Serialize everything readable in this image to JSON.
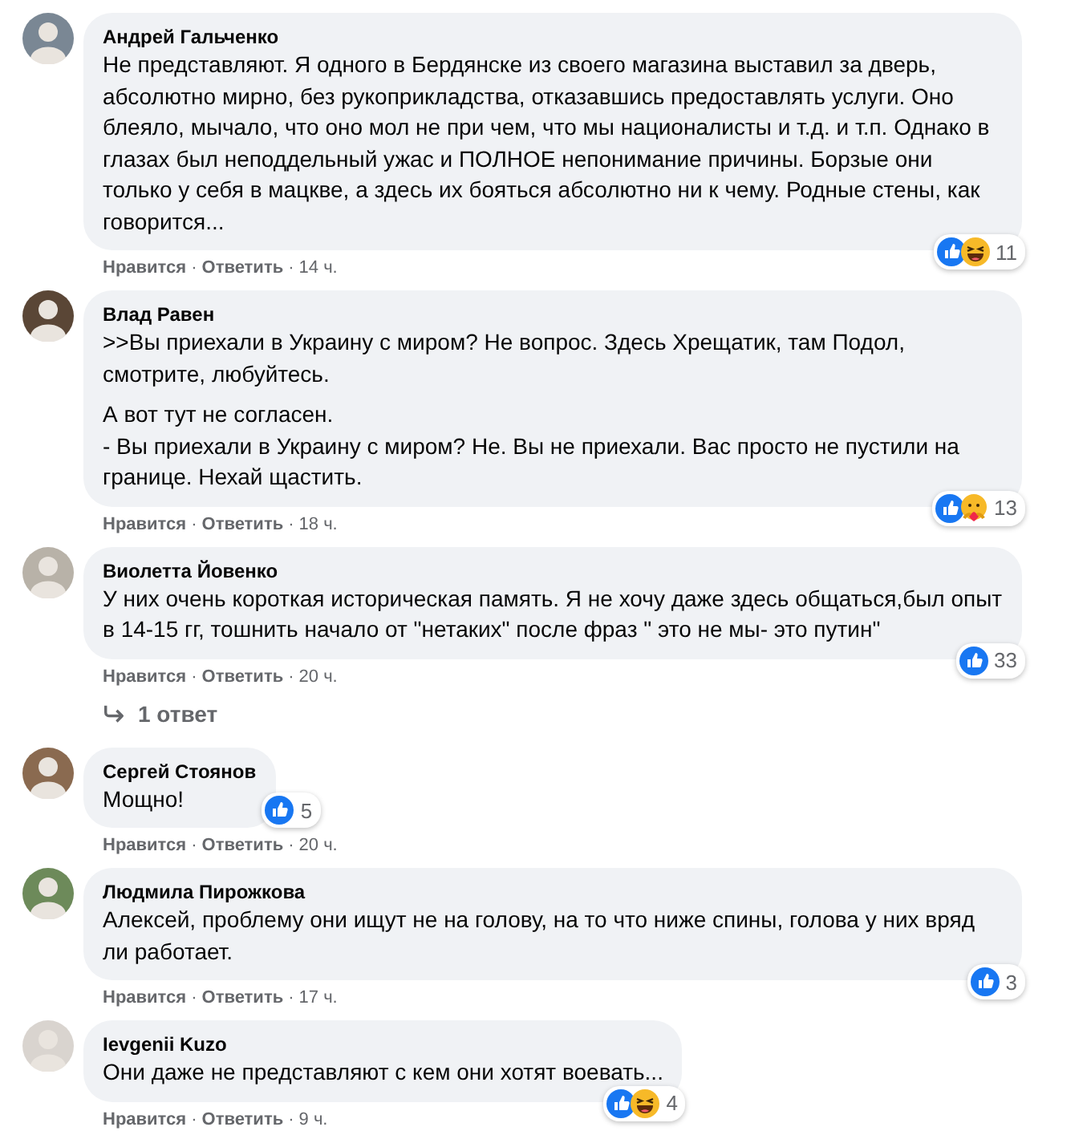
{
  "separator": "·",
  "comments": [
    {
      "author": "Андрей Гальченко",
      "paragraphs": [
        "Не представляют. Я одного в Бердянске из своего магазина выставил за дверь, абсолютно мирно, без рукоприкладства, отказавшись предоставлять услуги. Оно блеяло, мычало, что оно мол не при чем, что мы националисты и т.д. и т.п. Однако в глазах был неподдельный ужас и ПОЛНОЕ непонимание причины. Борзые они только у себя в мацкве, а здесь их бояться абсолютно ни к чему. Родные стены, как говорится..."
      ],
      "reactions": [
        {
          "kind": "like"
        },
        {
          "kind": "haha"
        }
      ],
      "reaction_count": "11",
      "like_label": "Нравится",
      "reply_label": "Ответить",
      "time": "14 ч."
    },
    {
      "author": "Влад Равен",
      "paragraphs": [
        ">>Вы приехали в Украину с миром? Не вопрос. Здесь Хрещатик, там Подол, смотрите, любуйтесь.",
        "А вот тут не согласен.\n- Вы приехали в Украину с миром? Не. Вы не приехали. Вас просто не пустили на границе. Нехай щастить."
      ],
      "reactions": [
        {
          "kind": "like"
        },
        {
          "kind": "care"
        }
      ],
      "reaction_count": "13",
      "like_label": "Нравится",
      "reply_label": "Ответить",
      "time": "18 ч."
    },
    {
      "author": "Виолетта Йовенко",
      "paragraphs": [
        "У них очень короткая историческая память. Я не хочу даже здесь общаться,был опыт в 14-15 гг, тошнить начало от \"нетаких\" после фраз \" это не мы- это путин\""
      ],
      "reactions": [
        {
          "kind": "like"
        }
      ],
      "reaction_count": "33",
      "like_label": "Нравится",
      "reply_label": "Ответить",
      "time": "20 ч.",
      "replies_label": "1 ответ"
    },
    {
      "author": "Сергей Стоянов",
      "paragraphs": [
        "Мощно!"
      ],
      "reactions": [
        {
          "kind": "like"
        }
      ],
      "reaction_count": "5",
      "like_label": "Нравится",
      "reply_label": "Ответить",
      "time": "20 ч."
    },
    {
      "author": "Людмила Пирожкова",
      "paragraphs": [
        "Алексей, проблему они ищут не на голову, на то что ниже спины, голова у них вряд ли работает."
      ],
      "reactions": [
        {
          "kind": "like"
        }
      ],
      "reaction_count": "3",
      "like_label": "Нравится",
      "reply_label": "Ответить",
      "time": "17 ч."
    },
    {
      "author": "Ievgenii Kuzo",
      "paragraphs": [
        "Они даже не представляют с кем они хотят воевать..."
      ],
      "reactions": [
        {
          "kind": "like"
        },
        {
          "kind": "haha"
        }
      ],
      "reaction_count": "4",
      "like_label": "Нравится",
      "reply_label": "Ответить",
      "time": "9 ч."
    }
  ]
}
